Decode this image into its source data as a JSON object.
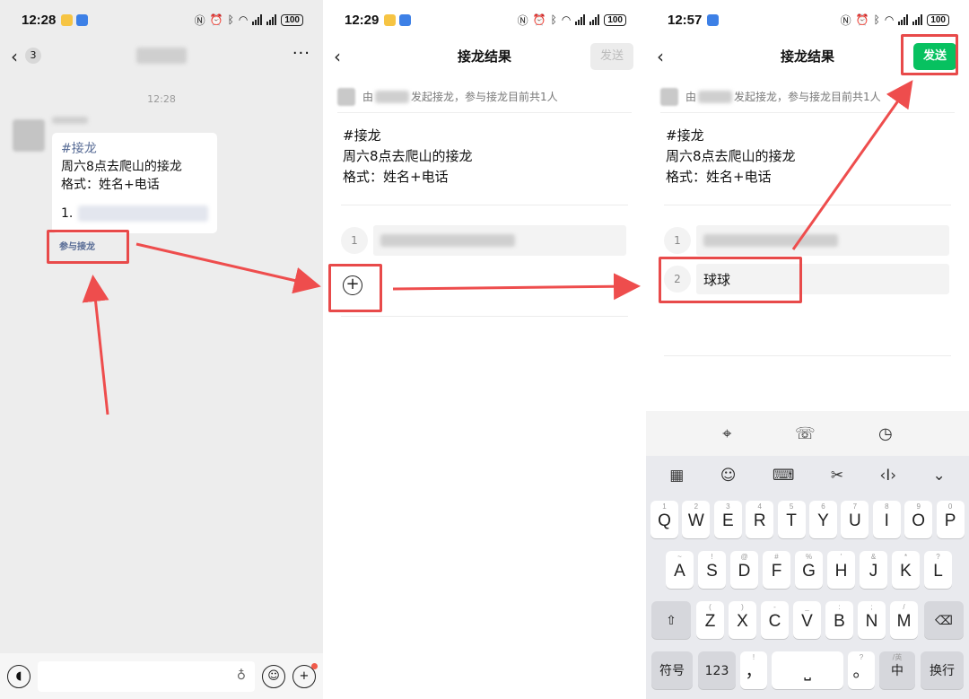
{
  "panel1": {
    "status_time": "12:28",
    "battery": "100",
    "back_badge": "3",
    "more": "···",
    "chat_time": "12:28",
    "bubble": {
      "tag": "#接龙",
      "line1": "周六8点去爬山的接龙",
      "line2": "格式：姓名+电话",
      "entry_num": "1."
    },
    "join_link": "参与接龙"
  },
  "panel2": {
    "status_time": "12:29",
    "battery": "100",
    "title": "接龙结果",
    "send": "发送",
    "info_prefix": "由",
    "info_suffix": "发起接龙，参与接龙目前共1人",
    "jl_lines": [
      "#接龙",
      "周六8点去爬山的接龙",
      "格式：姓名+电话"
    ],
    "entries": [
      {
        "num": "1"
      }
    ]
  },
  "panel3": {
    "status_time": "12:57",
    "battery": "100",
    "title": "接龙结果",
    "send": "发送",
    "info_prefix": "由",
    "info_suffix": "发起接龙，参与接龙目前共1人",
    "jl_lines": [
      "#接龙",
      "周六8点去爬山的接龙",
      "格式：姓名+电话"
    ],
    "entries": [
      {
        "num": "1"
      },
      {
        "num": "2",
        "value": "球球"
      }
    ],
    "keyboard": {
      "row1": [
        {
          "k": "Q",
          "h": "1"
        },
        {
          "k": "W",
          "h": "2"
        },
        {
          "k": "E",
          "h": "3"
        },
        {
          "k": "R",
          "h": "4"
        },
        {
          "k": "T",
          "h": "5"
        },
        {
          "k": "Y",
          "h": "6"
        },
        {
          "k": "U",
          "h": "7"
        },
        {
          "k": "I",
          "h": "8"
        },
        {
          "k": "O",
          "h": "9"
        },
        {
          "k": "P",
          "h": "0"
        }
      ],
      "row2": [
        {
          "k": "A",
          "h": "~"
        },
        {
          "k": "S",
          "h": "!"
        },
        {
          "k": "D",
          "h": "@"
        },
        {
          "k": "F",
          "h": "#"
        },
        {
          "k": "G",
          "h": "%"
        },
        {
          "k": "H",
          "h": "'"
        },
        {
          "k": "J",
          "h": "&"
        },
        {
          "k": "K",
          "h": "*"
        },
        {
          "k": "L",
          "h": "?"
        }
      ],
      "row3": [
        {
          "k": "Z",
          "h": "("
        },
        {
          "k": "X",
          "h": ")"
        },
        {
          "k": "C",
          "h": "-"
        },
        {
          "k": "V",
          "h": "_"
        },
        {
          "k": "B",
          "h": ":"
        },
        {
          "k": "N",
          "h": ";"
        },
        {
          "k": "M",
          "h": "/"
        }
      ],
      "symbols": "符号",
      "numbers": "123",
      "comma": "，",
      "comma_hint": "!",
      "period": "。",
      "period_hint": "?",
      "lang": "中",
      "lang_sub": "/英",
      "enter": "换行"
    }
  }
}
